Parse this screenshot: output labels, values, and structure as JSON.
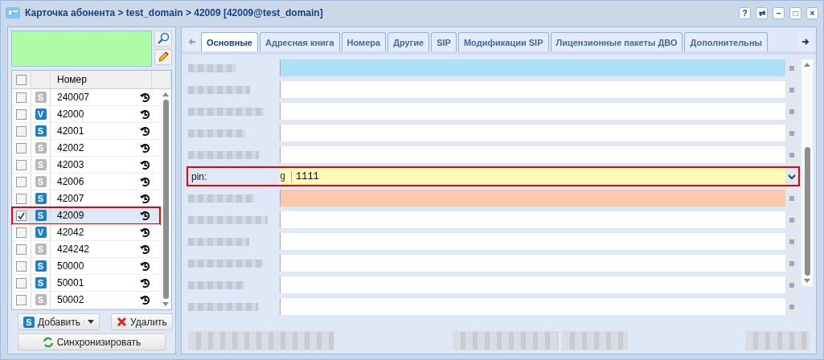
{
  "window": {
    "title": "Карточка абонента > test_domain > 42009 [42009@test_domain]",
    "buttons": [
      "?",
      "⇄",
      "–",
      "□",
      "×"
    ]
  },
  "list": {
    "header": "Номер",
    "all_checked": false,
    "rows": [
      {
        "number": "240007",
        "type": "S",
        "active": false,
        "checked": false,
        "selected": false
      },
      {
        "number": "42000",
        "type": "V",
        "active": true,
        "checked": false,
        "selected": false
      },
      {
        "number": "42001",
        "type": "S",
        "active": true,
        "checked": false,
        "selected": false
      },
      {
        "number": "42002",
        "type": "S",
        "active": false,
        "checked": false,
        "selected": false
      },
      {
        "number": "42003",
        "type": "S",
        "active": false,
        "checked": false,
        "selected": false
      },
      {
        "number": "42006",
        "type": "S",
        "active": false,
        "checked": false,
        "selected": false
      },
      {
        "number": "42007",
        "type": "S",
        "active": true,
        "checked": false,
        "selected": false
      },
      {
        "number": "42009",
        "type": "S",
        "active": true,
        "checked": true,
        "selected": true
      },
      {
        "number": "42042",
        "type": "V",
        "active": true,
        "checked": false,
        "selected": false
      },
      {
        "number": "424242",
        "type": "S",
        "active": false,
        "checked": false,
        "selected": false
      },
      {
        "number": "50000",
        "type": "S",
        "active": true,
        "checked": false,
        "selected": false
      },
      {
        "number": "50001",
        "type": "S",
        "active": true,
        "checked": false,
        "selected": false
      },
      {
        "number": "50002",
        "type": "S",
        "active": false,
        "checked": false,
        "selected": false
      }
    ]
  },
  "list_buttons": {
    "add": {
      "label": "Добавить",
      "icon": "S"
    },
    "delete": "Удалить",
    "sync": "Синхронизировать"
  },
  "tabs": [
    {
      "label": "Основные",
      "selected": true
    },
    {
      "label": "Адресная книга",
      "selected": false
    },
    {
      "label": "Номера",
      "selected": false
    },
    {
      "label": "Другие",
      "selected": false
    },
    {
      "label": "SIP",
      "selected": false
    },
    {
      "label": "Модификации SIP",
      "selected": false
    },
    {
      "label": "Лицензионные пакеты ДВО",
      "selected": false
    },
    {
      "label": "Дополнительны",
      "selected": false
    }
  ],
  "form": [
    {
      "kind": "blurred",
      "color": "#aee0f8"
    },
    {
      "kind": "blurred",
      "color": "#ffffff"
    },
    {
      "kind": "blurred",
      "color": "#ffffff"
    },
    {
      "kind": "blurred",
      "color": "#ffffff"
    },
    {
      "kind": "blurred",
      "color": "#ffffff"
    },
    {
      "kind": "field",
      "label": "pin:",
      "prefix": "g",
      "value": "1111",
      "color": "#fffbb9"
    },
    {
      "kind": "blurred",
      "color": "#fec8ac"
    },
    {
      "kind": "blurred",
      "color": "#ffffff"
    },
    {
      "kind": "blurred",
      "color": "#ffffff"
    },
    {
      "kind": "blurred",
      "color": "#ffffff"
    },
    {
      "kind": "blurred",
      "color": "#ffffff"
    },
    {
      "kind": "blurred",
      "color": "#ffffff"
    }
  ]
}
